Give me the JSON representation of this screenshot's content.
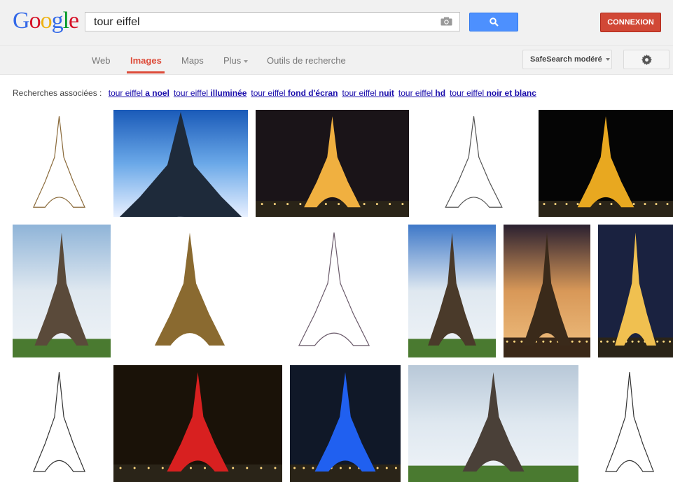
{
  "header": {
    "logo_letters": [
      {
        "char": "G",
        "color": "#3369e8"
      },
      {
        "char": "o",
        "color": "#d50f25"
      },
      {
        "char": "o",
        "color": "#eeb211"
      },
      {
        "char": "g",
        "color": "#3369e8"
      },
      {
        "char": "l",
        "color": "#009925"
      },
      {
        "char": "e",
        "color": "#d50f25"
      }
    ],
    "search_value": "tour eiffel",
    "search_icon": "magnifier-icon",
    "camera_icon": "camera-icon",
    "signin_label": "CONNEXION"
  },
  "nav": {
    "web": "Web",
    "images": "Images",
    "maps": "Maps",
    "plus": "Plus",
    "tools": "Outils de recherche",
    "safesearch": "SafeSearch modéré",
    "settings_icon": "gear-icon"
  },
  "related": {
    "label": "Recherches associées :",
    "items": [
      {
        "plain": "tour eiffel ",
        "bold": "a noel"
      },
      {
        "plain": "tour eiffel ",
        "bold": "illuminée"
      },
      {
        "plain": "tour eiffel ",
        "bold": "fond d'écran"
      },
      {
        "plain": "tour eiffel ",
        "bold": "nuit"
      },
      {
        "plain": "tour eiffel ",
        "bold": "hd"
      },
      {
        "plain": "tour eiffel ",
        "bold": "noir et blanc"
      }
    ]
  },
  "images": [
    {
      "style": "diagram",
      "bg": "#ffffff",
      "tower": "#8a6a3a"
    },
    {
      "style": "sky-angle",
      "bg": "#3a7bd0",
      "tower": "#1e2a3a"
    },
    {
      "style": "night-gold",
      "bg": "#1a1418",
      "tower": "#f0b040"
    },
    {
      "style": "diagram",
      "bg": "#ffffff",
      "tower": "#555555"
    },
    {
      "style": "night-gold",
      "bg": "#050505",
      "tower": "#e8a820"
    },
    {
      "style": "day",
      "bg": "#8fb4d8",
      "tower": "#5a4a3a"
    },
    {
      "style": "souvenir",
      "bg": "#ffffff",
      "tower": "#8a6a30"
    },
    {
      "style": "sketch",
      "bg": "#ffffff",
      "tower": "#6a5a6a"
    },
    {
      "style": "day",
      "bg": "#3e78c8",
      "tower": "#4a3a2a"
    },
    {
      "style": "sunset",
      "bg": "#c88a50",
      "tower": "#3a2a1a"
    },
    {
      "style": "night-gold",
      "bg": "#1a2240",
      "tower": "#f0c050"
    },
    {
      "style": "lineart",
      "bg": "#ffffff",
      "tower": "#333333"
    },
    {
      "style": "night-red",
      "bg": "#1a1208",
      "tower": "#d82020"
    },
    {
      "style": "night-blue",
      "bg": "#101828",
      "tower": "#2060f0"
    },
    {
      "style": "day",
      "bg": "#b8c8d8",
      "tower": "#4a4038"
    },
    {
      "style": "lineart",
      "bg": "#ffffff",
      "tower": "#333333"
    }
  ]
}
